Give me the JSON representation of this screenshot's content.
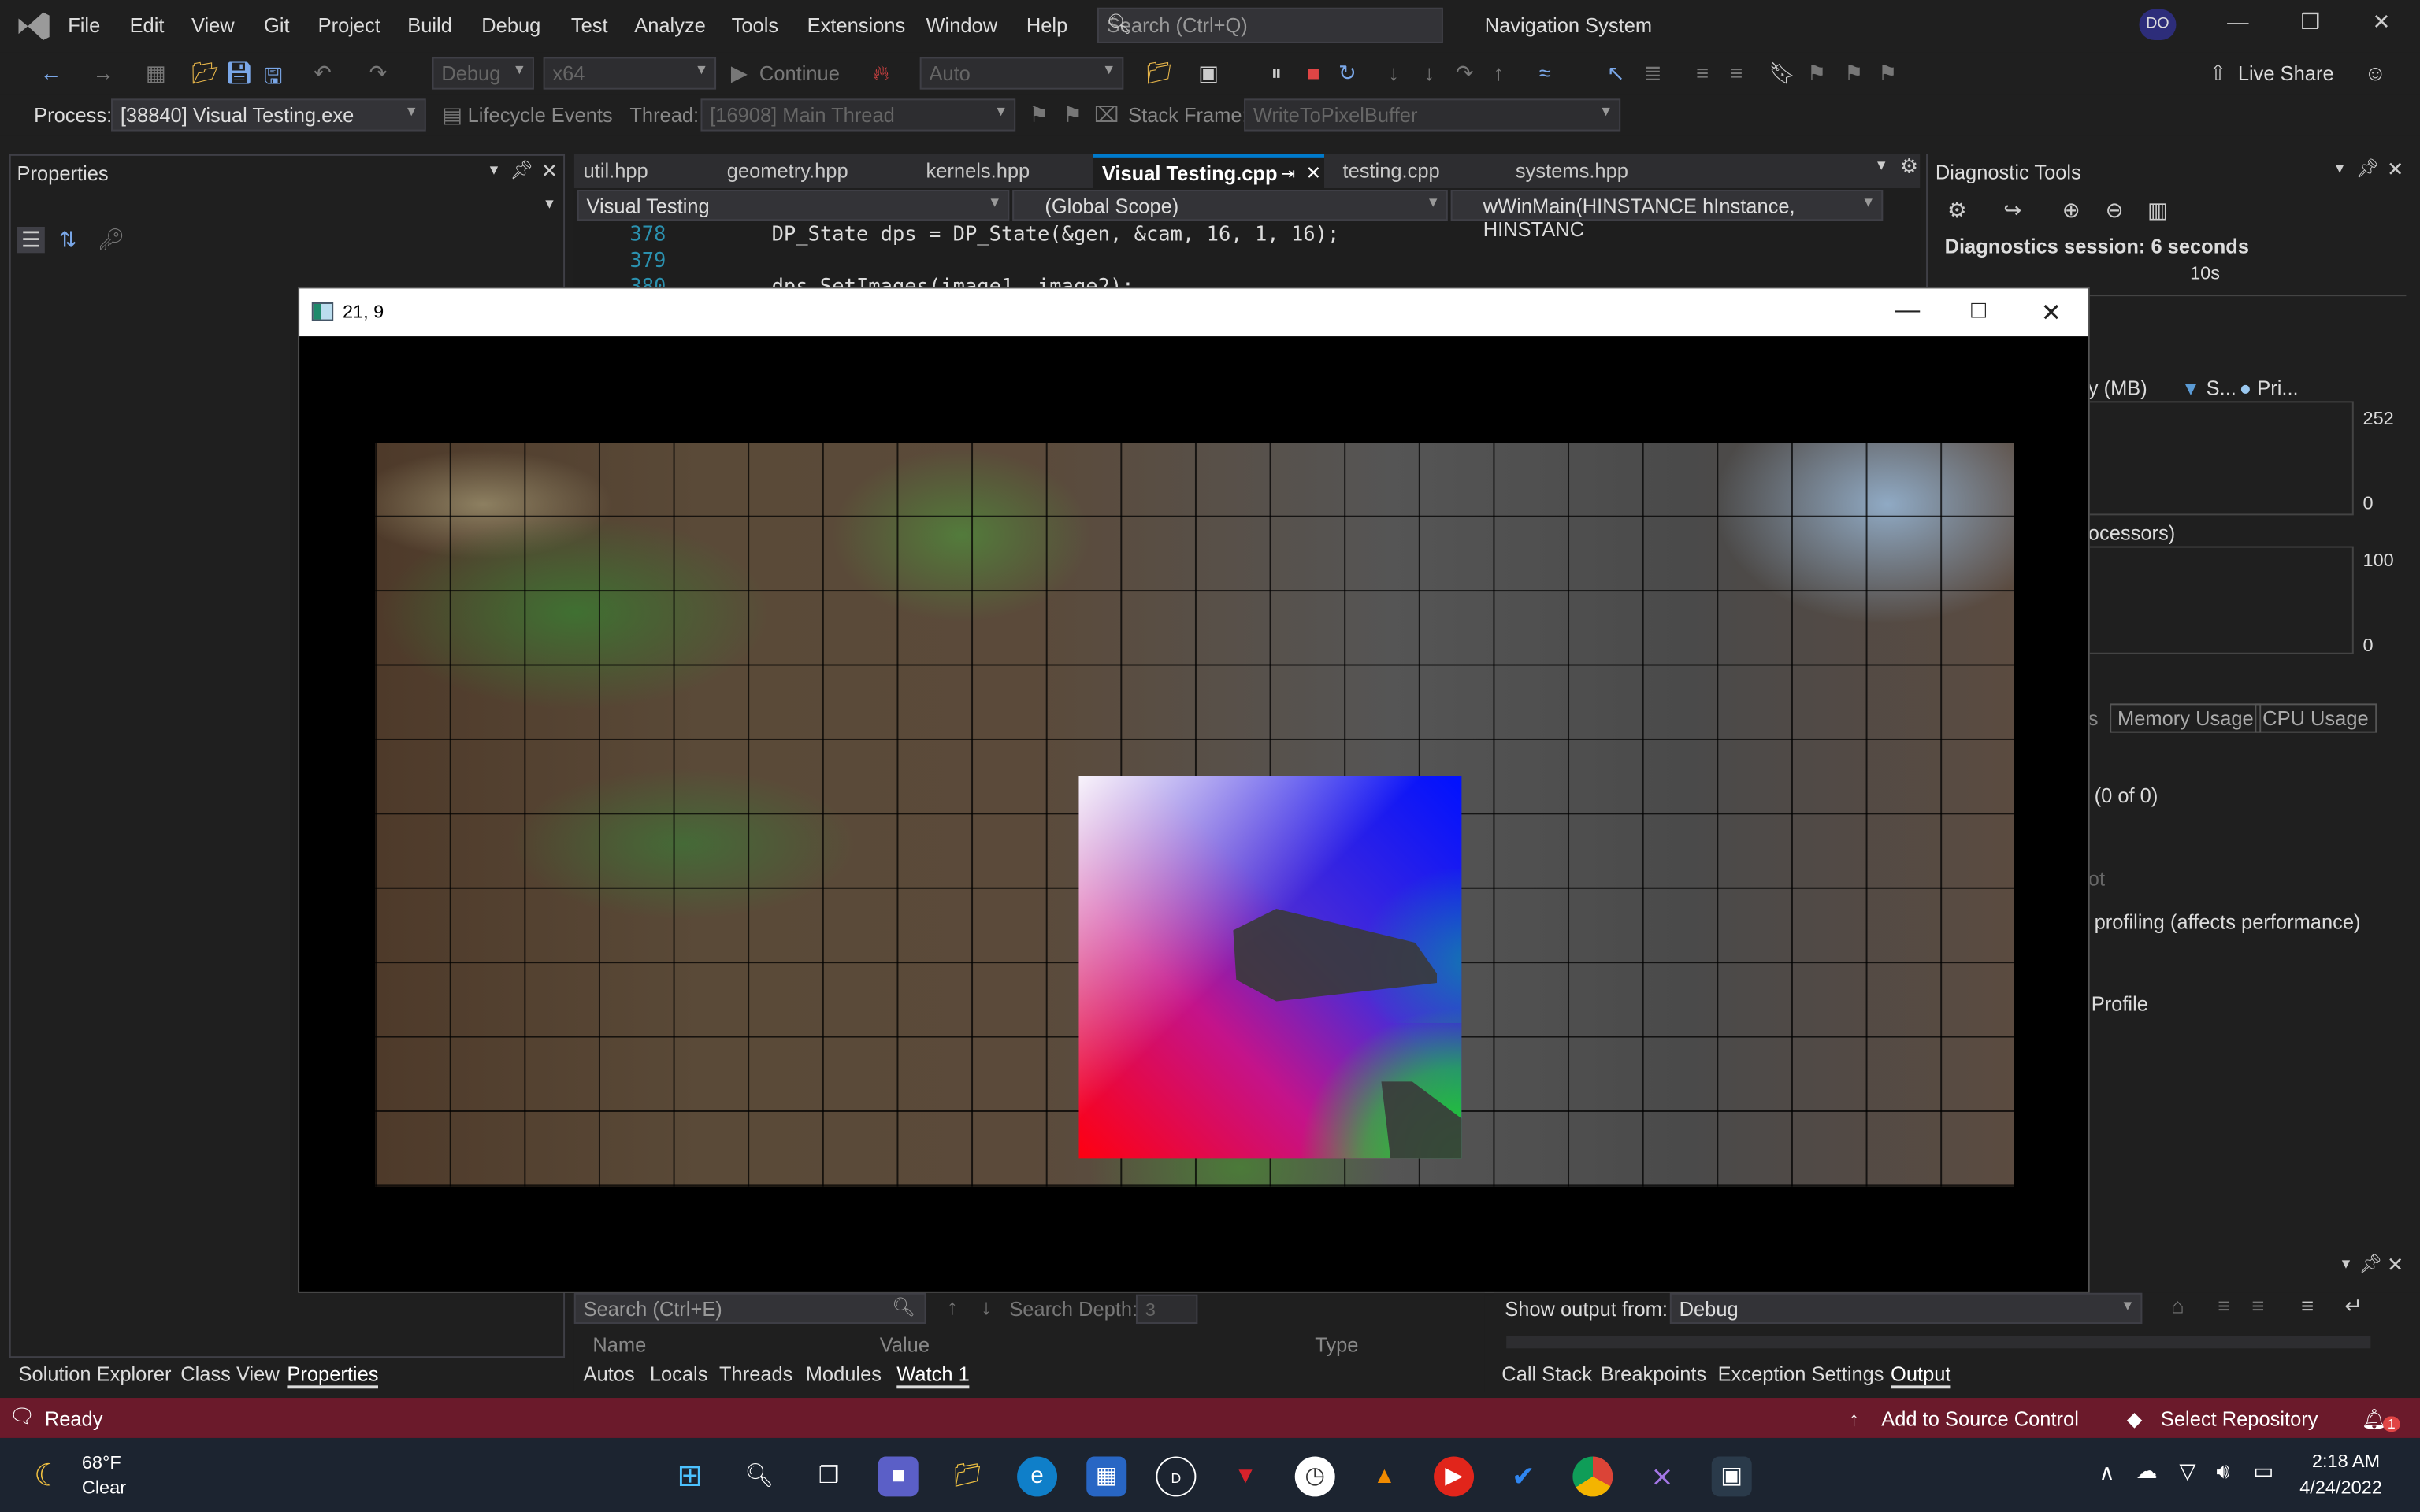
{
  "menubar": {
    "items": [
      "File",
      "Edit",
      "View",
      "Git",
      "Project",
      "Build",
      "Debug",
      "Test",
      "Analyze",
      "Tools",
      "Extensions",
      "Window",
      "Help"
    ],
    "search_placeholder": "Search (Ctrl+Q)",
    "solution_name": "Navigation System",
    "avatar_initials": "DO"
  },
  "toolbar": {
    "config": "Debug",
    "platform": "x64",
    "continue_label": "Continue",
    "target": "Auto",
    "live_share": "Live Share"
  },
  "debug_location": {
    "process_label": "Process:",
    "process_value": "[38840] Visual Testing.exe",
    "lifecycle_label": "Lifecycle Events",
    "thread_label": "Thread:",
    "thread_value": "[16908] Main Thread",
    "stack_label": "Stack Frame:",
    "stack_value": "WriteToPixelBuffer"
  },
  "properties": {
    "title": "Properties"
  },
  "editor": {
    "tabs": [
      "util.hpp",
      "geometry.hpp",
      "kernels.hpp",
      "Visual Testing.cpp",
      "testing.cpp",
      "systems.hpp"
    ],
    "active_tab": "Visual Testing.cpp",
    "project_dropdown": "Visual Testing",
    "scope_dropdown": "(Global Scope)",
    "member_dropdown": "wWinMain(HINSTANCE hInstance, HINSTANC",
    "lines": [
      {
        "no": "378",
        "code": "DP_State dps = DP_State(&gen, &cam, 16, 1, 16);"
      },
      {
        "no": "379",
        "code": ""
      },
      {
        "no": "380",
        "code": "dps.SetImages(image1, image2);"
      }
    ]
  },
  "diagnostics": {
    "title": "Diagnostic Tools",
    "session": "Diagnostics session: 6 seconds",
    "timeline_label": "10s",
    "memory_label": "y (MB)",
    "legend_s": "S...",
    "legend_p": "Pri...",
    "mem_max": "252",
    "mem_min": "0",
    "cpu_label": "ocessors)",
    "cpu_max": "100",
    "cpu_min": "0",
    "tab_memory": "Memory Usage",
    "tab_cpu": "CPU Usage",
    "tab_partial": "s",
    "events": "(0 of 0)",
    "snapshot_partial": "ot",
    "profiling": "profiling (affects performance)",
    "profile": "Profile"
  },
  "app_window": {
    "title": "21, 9"
  },
  "watch": {
    "search_placeholder": "Search (Ctrl+E)",
    "depth_label": "Search Depth:",
    "depth_value": "3",
    "col_name": "Name",
    "col_value": "Value",
    "col_type": "Type"
  },
  "output": {
    "show_from_label": "Show output from:",
    "show_from_value": "Debug"
  },
  "bottom_tabs_left": [
    "Solution Explorer",
    "Class View",
    "Properties"
  ],
  "bottom_tabs_middle": [
    "Autos",
    "Locals",
    "Threads",
    "Modules",
    "Watch 1"
  ],
  "bottom_tabs_right": [
    "Call Stack",
    "Breakpoints",
    "Exception Settings",
    "Output"
  ],
  "statusbar": {
    "ready": "Ready",
    "source_control": "Add to Source Control",
    "repository": "Select Repository",
    "notifications": "1"
  },
  "taskbar": {
    "weather_temp": "68°F",
    "weather_cond": "Clear",
    "time": "2:18 AM",
    "date": "4/24/2022"
  },
  "colors": {
    "statusbar": "#6b1a2b",
    "accent": "#007acc"
  }
}
